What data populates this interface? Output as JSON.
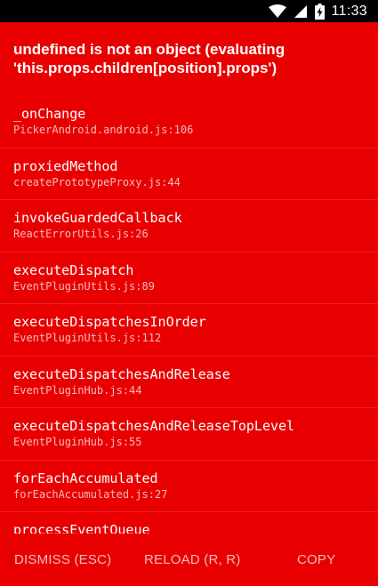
{
  "status_bar": {
    "time": "11:33",
    "icons": [
      "wifi-icon",
      "signal-icon",
      "battery-charging-icon"
    ]
  },
  "error": {
    "title": "undefined is not an object (evaluating 'this.props.children[position].props')"
  },
  "stack": [
    {
      "method": "_onChange",
      "file": "PickerAndroid.android.js:106"
    },
    {
      "method": "proxiedMethod",
      "file": "createPrototypeProxy.js:44"
    },
    {
      "method": "invokeGuardedCallback",
      "file": "ReactErrorUtils.js:26"
    },
    {
      "method": "executeDispatch",
      "file": "EventPluginUtils.js:89"
    },
    {
      "method": "executeDispatchesInOrder",
      "file": "EventPluginUtils.js:112"
    },
    {
      "method": "executeDispatchesAndRelease",
      "file": "EventPluginHub.js:44"
    },
    {
      "method": "executeDispatchesAndReleaseTopLevel",
      "file": "EventPluginHub.js:55"
    },
    {
      "method": "forEachAccumulated",
      "file": "forEachAccumulated.js:27"
    },
    {
      "method": "processEventQueue",
      "file": ""
    }
  ],
  "buttons": {
    "dismiss": "DISMISS (ESC)",
    "reload": "RELOAD (R, R)",
    "copy": "COPY"
  },
  "colors": {
    "background": "#e80000",
    "status_bar": "#000000",
    "text": "#ffffff"
  }
}
